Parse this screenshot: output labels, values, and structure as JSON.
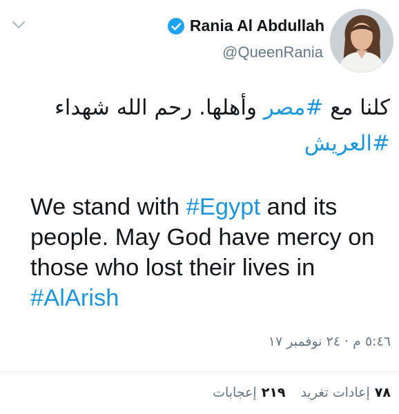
{
  "author": {
    "display_name": "Rania Al Abdullah",
    "handle": "@QueenRania",
    "verified": true,
    "avatar_icon": "profile-photo"
  },
  "menu_icon": "chevron-down-icon",
  "tweet": {
    "ar_text_1": "كلنا مع ",
    "ar_hashtag_1": "#مصر",
    "ar_text_2": " وأهلها. رحم الله شهداء ",
    "ar_hashtag_2": "#العريش",
    "en_text_1": "We stand with ",
    "en_hashtag_1": "#Egypt",
    "en_text_2": " and its people. May God have mercy on those who lost their lives in ",
    "en_hashtag_2": "#AlArish"
  },
  "timestamp": "٥:٤٦ م · ٢٤ نوفمبر ١٧",
  "stats": {
    "retweets_count": "٧٨",
    "retweets_label": "إعادات تغريد",
    "likes_count": "٢١٩",
    "likes_label": "إعجابات"
  },
  "colors": {
    "text": "#14171a",
    "secondary": "#657786",
    "link": "#1b95e0",
    "verified_badge": "#1da1f2",
    "divider": "#e6ecf0"
  }
}
